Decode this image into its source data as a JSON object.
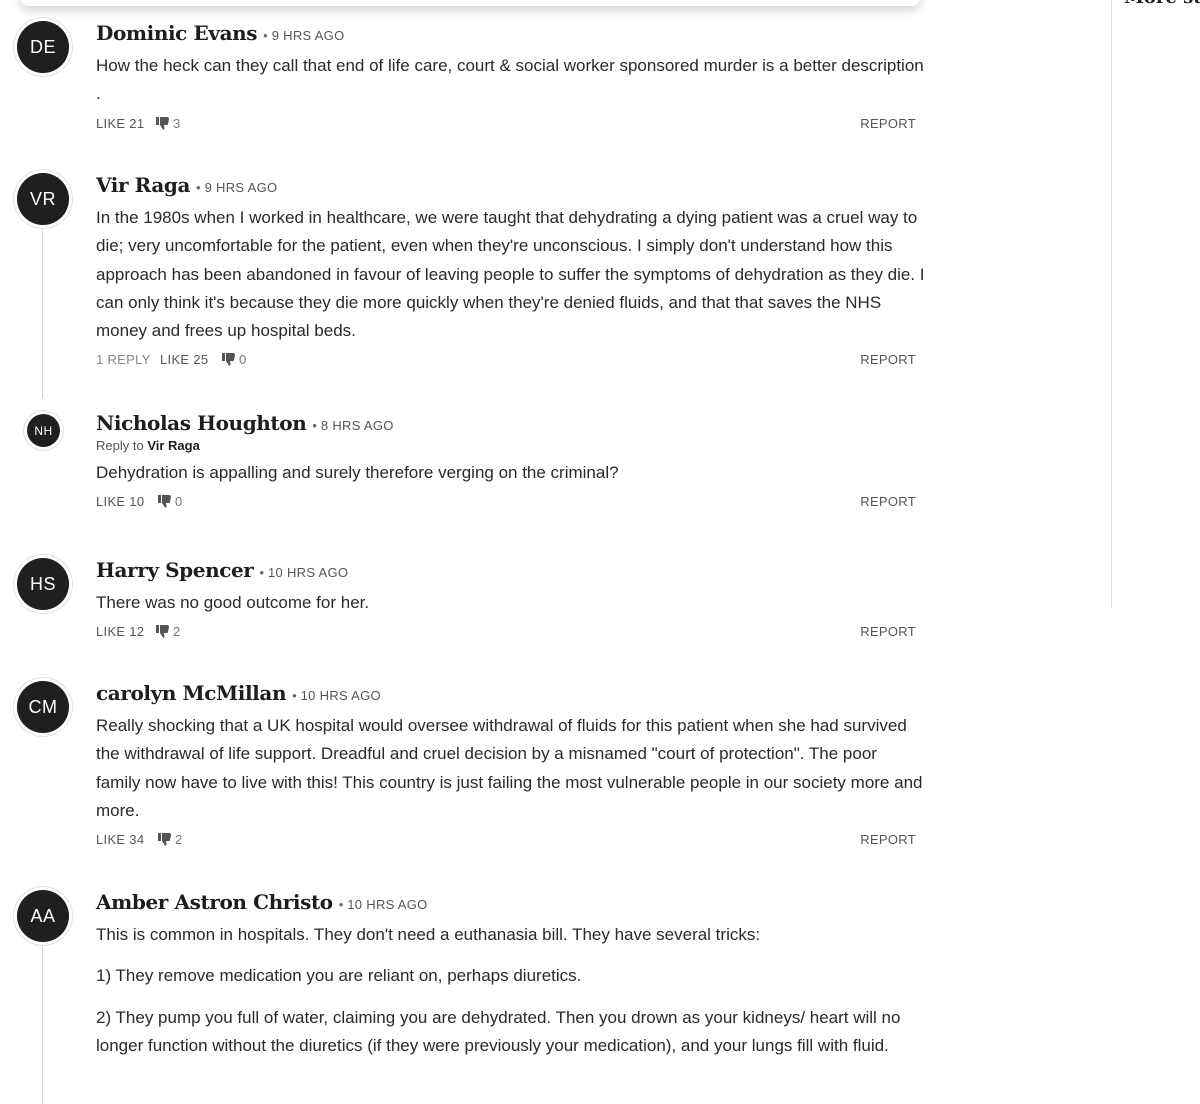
{
  "sidebar": {
    "heading": "More stories"
  },
  "icons": {
    "dislike": "thumbs-down-icon"
  },
  "comments": [
    {
      "initials": "DE",
      "author": "Dominic Evans",
      "time": "9 HRS AGO",
      "paragraphs": [
        "How the heck can they call that end of life care, court & social worker sponsored murder is a better description ."
      ],
      "like_label": "LIKE 21",
      "dislikes": "3",
      "report": "REPORT"
    },
    {
      "initials": "VR",
      "author": "Vir Raga",
      "time": "9 HRS AGO",
      "paragraphs": [
        "In the 1980s when I worked in healthcare, we were taught that dehydrating a dying patient was a cruel way to die; very uncomfortable for the patient, even when they're unconscious. I simply don't understand how this approach has been abandoned in favour of leaving people to suffer the symptoms of dehydration as they die. I can only think it's because they die more quickly when they're denied fluids, and that that saves the NHS money and frees up hospital beds."
      ],
      "replies_label": "1 REPLY",
      "like_label": "LIKE 25",
      "dislikes": "0",
      "report": "REPORT"
    },
    {
      "initials": "NH",
      "author": "Nicholas Houghton",
      "time": "8 HRS AGO",
      "reply_to_prefix": "Reply to",
      "reply_to_name": "Vir Raga",
      "paragraphs": [
        "Dehydration is appalling and surely therefore verging on the criminal?"
      ],
      "like_label": "LIKE 10",
      "dislikes": "0",
      "report": "REPORT"
    },
    {
      "initials": "HS",
      "author": "Harry Spencer",
      "time": "10 HRS AGO",
      "paragraphs": [
        "There was no good outcome for her."
      ],
      "like_label": "LIKE 12",
      "dislikes": "2",
      "report": "REPORT"
    },
    {
      "initials": "CM",
      "author": "carolyn McMillan",
      "time": "10 HRS AGO",
      "paragraphs": [
        "Really shocking that a UK hospital would oversee withdrawal of fluids for this patient when she had survived the withdrawal of life support. Dreadful and cruel decision by a misnamed \"court of protection\". The poor family now have to live with this! This country is just failing the most vulnerable people in our society more and more."
      ],
      "like_label": "LIKE 34",
      "dislikes": "2",
      "report": "REPORT"
    },
    {
      "initials": "AA",
      "author": "Amber Astron Christo",
      "time": "10 HRS AGO",
      "paragraphs": [
        "This is common in hospitals. They don't need a euthanasia bill. They have several tricks:",
        "1) They remove medication you are reliant on, perhaps diuretics.",
        "2) They pump you full of water, claiming you are dehydrated. Then you drown as your kidneys/ heart will no longer function without the diuretics (if they were previously your medication), and your lungs fill with fluid."
      ]
    }
  ]
}
